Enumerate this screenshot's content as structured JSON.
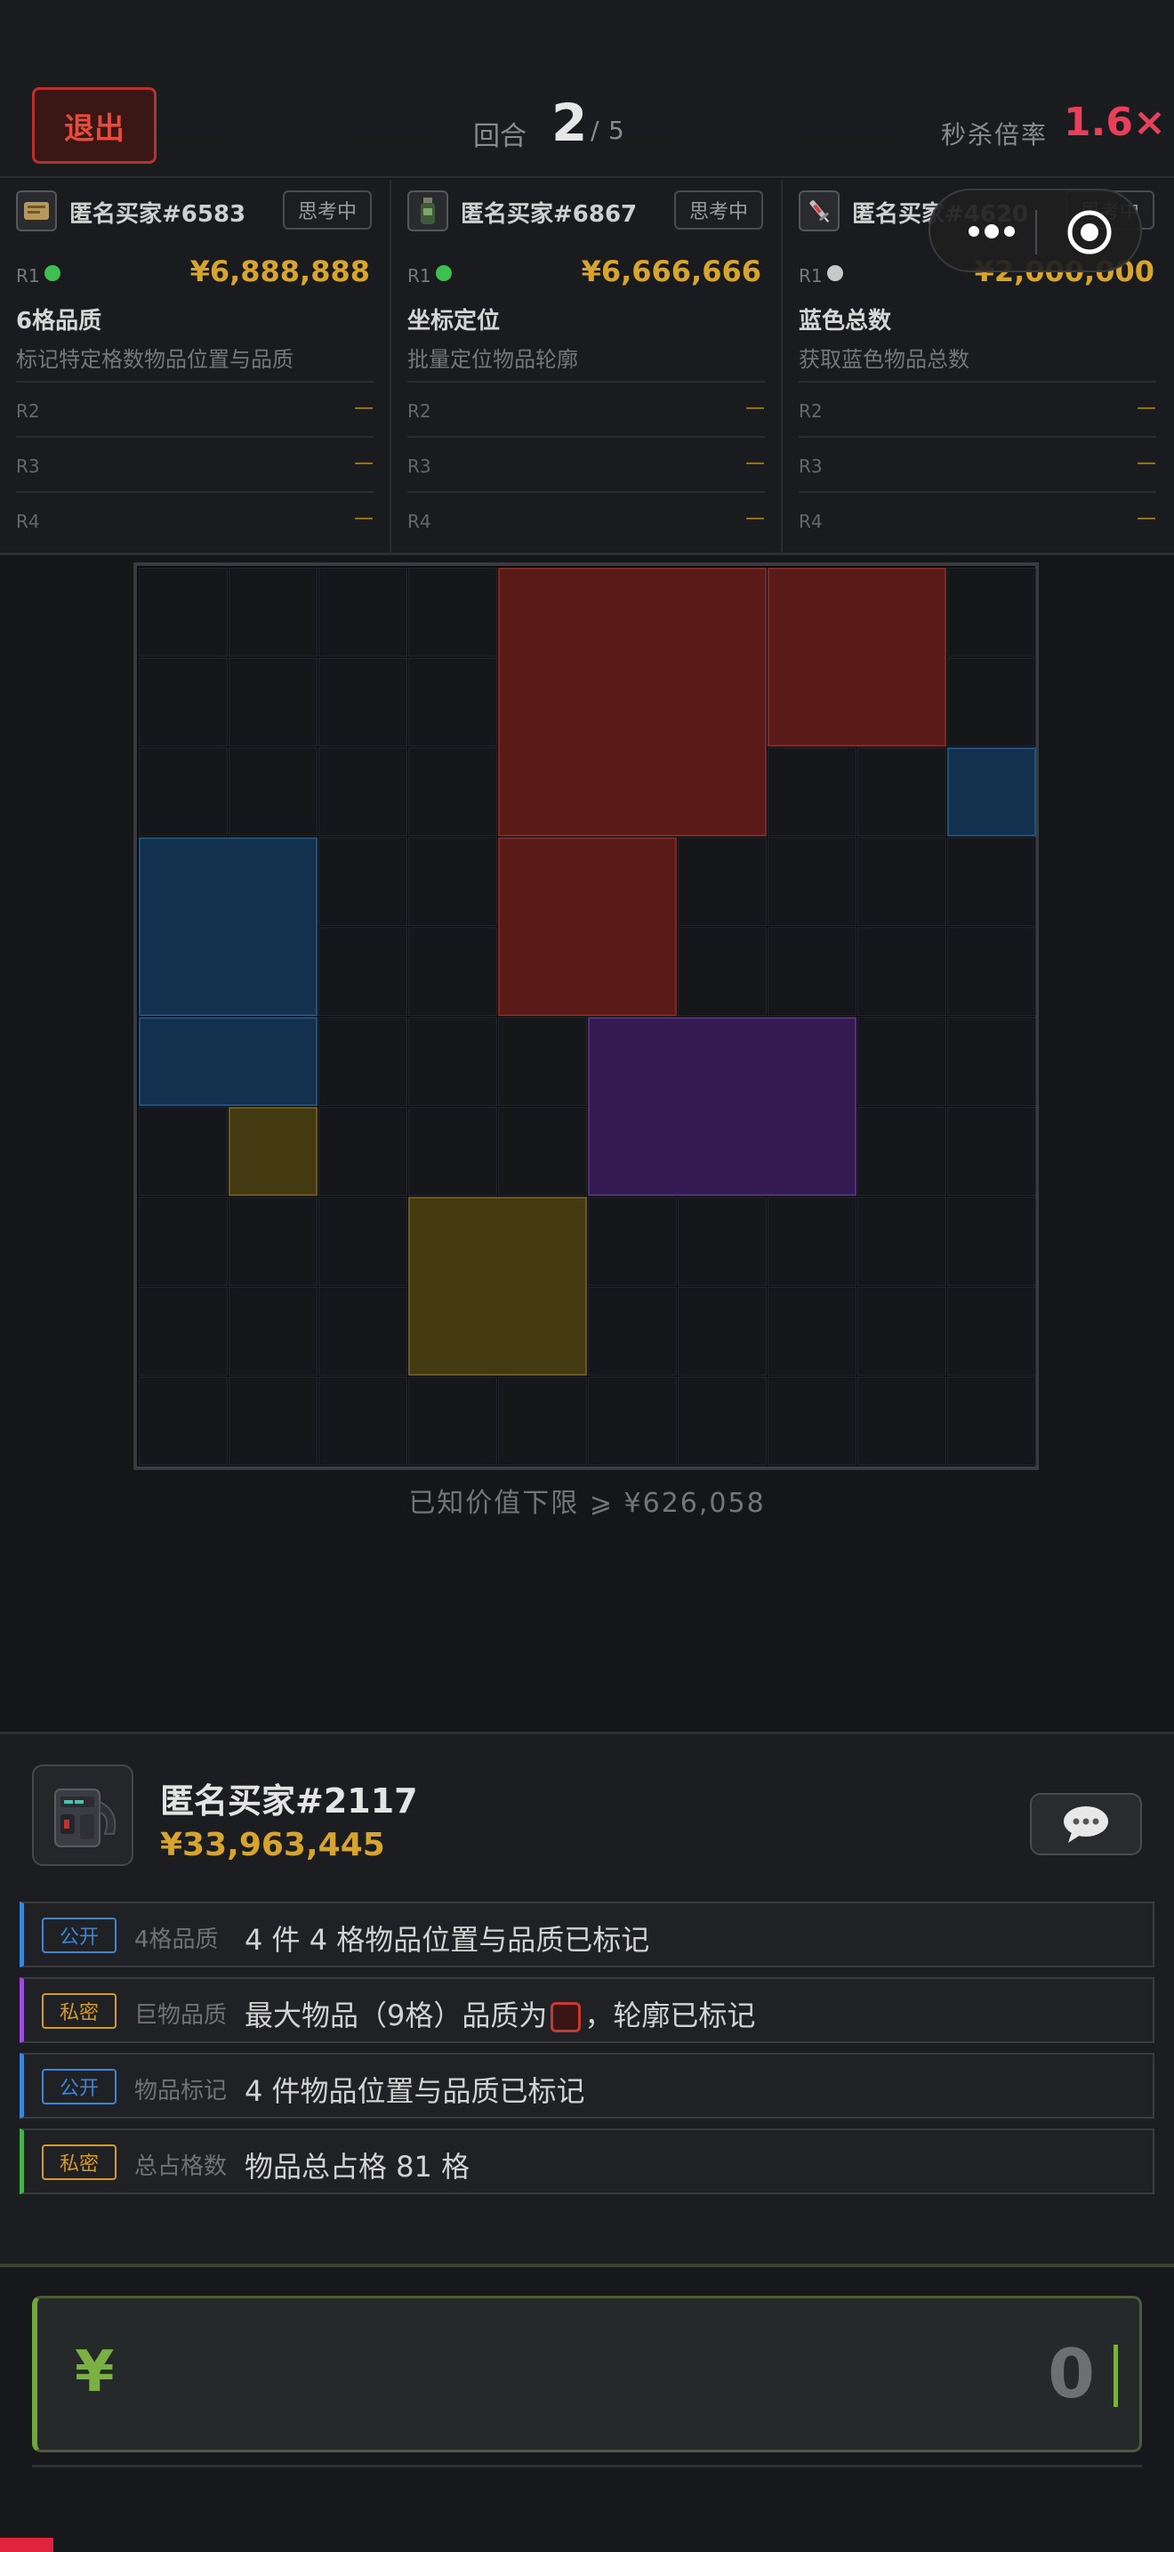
{
  "header": {
    "exit_label": "退出",
    "round_label": "回合",
    "round_current": "2",
    "round_sep": "/",
    "round_total": "5",
    "kill_label": "秒杀倍率",
    "kill_value": "1.6×"
  },
  "bidders": [
    {
      "name": "匿名买家#6583",
      "status": "思考中",
      "r1_label": "R1",
      "r1_status_color": "#3fbf4f",
      "price": "¥6,888,888",
      "skill": "6格品质",
      "desc": "标记特定格数物品位置与品质",
      "rows": [
        {
          "label": "R2",
          "value": "—"
        },
        {
          "label": "R3",
          "value": "—"
        },
        {
          "label": "R4",
          "value": "—"
        }
      ]
    },
    {
      "name": "匿名买家#6867",
      "status": "思考中",
      "r1_label": "R1",
      "r1_status_color": "#3fbf4f",
      "price": "¥6,666,666",
      "skill": "坐标定位",
      "desc": "批量定位物品轮廓",
      "rows": [
        {
          "label": "R2",
          "value": "—"
        },
        {
          "label": "R3",
          "value": "—"
        },
        {
          "label": "R4",
          "value": "—"
        }
      ]
    },
    {
      "name": "匿名买家#4620",
      "status": "思考中",
      "r1_label": "R1",
      "r1_status_color": "#c8c8c8",
      "price": "¥2,000,000",
      "skill": "蓝色总数",
      "desc": "获取蓝色物品总数",
      "rows": [
        {
          "label": "R2",
          "value": "—"
        },
        {
          "label": "R3",
          "value": "—"
        },
        {
          "label": "R4",
          "value": "—"
        }
      ]
    }
  ],
  "capsule": {
    "more_icon": "more-dots-icon",
    "close_icon": "target-close-icon"
  },
  "board": {
    "columns": 10,
    "rows": 10,
    "items": [
      {
        "color": "red",
        "col": 4,
        "row": 0,
        "w": 3,
        "h": 3
      },
      {
        "color": "red",
        "col": 7,
        "row": 0,
        "w": 2,
        "h": 2
      },
      {
        "color": "blue",
        "col": 9,
        "row": 2,
        "w": 1,
        "h": 1
      },
      {
        "color": "blue",
        "col": 0,
        "row": 3,
        "w": 2,
        "h": 2
      },
      {
        "color": "red",
        "col": 4,
        "row": 3,
        "w": 2,
        "h": 2
      },
      {
        "color": "blue",
        "col": 0,
        "row": 5,
        "w": 2,
        "h": 1
      },
      {
        "color": "purple",
        "col": 5,
        "row": 5,
        "w": 3,
        "h": 2
      },
      {
        "color": "gold",
        "col": 1,
        "row": 6,
        "w": 1,
        "h": 1
      },
      {
        "color": "gold",
        "col": 3,
        "row": 7,
        "w": 2,
        "h": 2
      }
    ],
    "colors": {
      "red": "#5a1a17",
      "blue": "#13304e",
      "purple": "#331a50",
      "gold": "#433a12"
    },
    "border_colors": {
      "red": "#7c2a24",
      "blue": "#23507a",
      "purple": "#55307a",
      "gold": "#6a5a1e"
    }
  },
  "lower_bound": "已知价值下限 ⩾ ¥626,058",
  "player": {
    "name": "匿名买家#2117",
    "money": "¥33,963,445",
    "avatar_icon": "backpack-avatar-icon",
    "chat_icon": "chat-bubble-icon"
  },
  "clues": [
    {
      "tag": "公开",
      "tag_color": "#3d86d4",
      "bar_color": "#3d86d4",
      "category": "4格品质",
      "text": "4 件 4 格物品位置与品质已标记"
    },
    {
      "tag": "私密",
      "tag_color": "#d49a2a",
      "bar_color": "#9b4fd8",
      "category": "巨物品质",
      "text_before": "最大物品（9格）品质为",
      "text_after": "，轮廓已标记"
    },
    {
      "tag": "公开",
      "tag_color": "#3d86d4",
      "bar_color": "#3d86d4",
      "category": "物品标记",
      "text": "4 件物品位置与品质已标记"
    },
    {
      "tag": "私密",
      "tag_color": "#d49a2a",
      "bar_color": "#48b04a",
      "category": "总占格数",
      "text": "物品总占格 81 格"
    }
  ],
  "bid": {
    "currency": "¥",
    "value": "0"
  }
}
